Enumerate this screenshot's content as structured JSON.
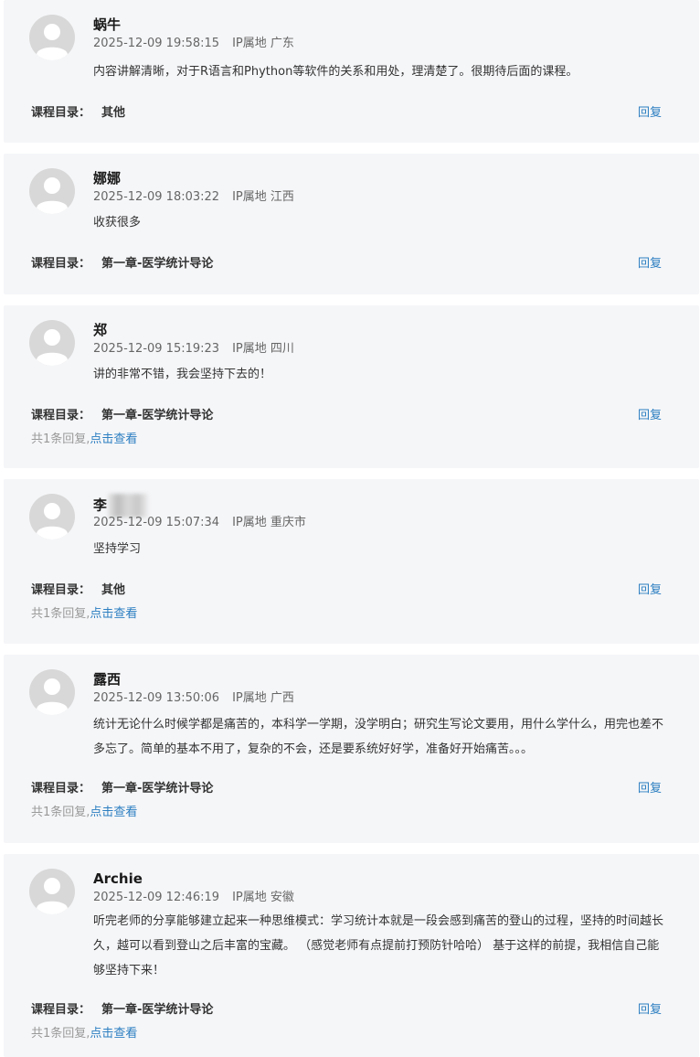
{
  "common": {
    "course_prefix": "课程目录：",
    "reply_label": "回复",
    "view_label": "点击查看"
  },
  "comments": [
    {
      "name": "蜗牛",
      "time": "2025-12-09 19:58:15",
      "ip": "IP属地 广东",
      "content": "内容讲解清晰，对于R语言和Phython等软件的关系和用处，理清楚了。很期待后面的课程。",
      "course": "其他",
      "reply_count": ""
    },
    {
      "name": "娜娜",
      "time": "2025-12-09 18:03:22",
      "ip": "IP属地 江西",
      "content": "收获很多",
      "course": "第一章-医学统计导论",
      "reply_count": ""
    },
    {
      "name": "郑",
      "time": "2025-12-09 15:19:23",
      "ip": "IP属地 四川",
      "content": "讲的非常不错，我会坚持下去的！",
      "course": "第一章-医学统计导论",
      "reply_count": "共1条回复,"
    },
    {
      "name": "李",
      "time": "2025-12-09 15:07:34",
      "ip": "IP属地 重庆市",
      "content": "坚持学习",
      "course": "其他",
      "reply_count": "共1条回复,"
    },
    {
      "name": "露西",
      "time": "2025-12-09 13:50:06",
      "ip": "IP属地 广西",
      "content": "统计无论什么时候学都是痛苦的，本科学一学期，没学明白；研究生写论文要用，用什么学什么，用完也差不多忘了。简单的基本不用了，复杂的不会，还是要系统好好学，准备好开始痛苦。。。",
      "course": "第一章-医学统计导论",
      "reply_count": "共1条回复,"
    },
    {
      "name": "Archie",
      "time": "2025-12-09 12:46:19",
      "ip": "IP属地 安徽",
      "content": "听完老师的分享能够建立起来一种思维模式：学习统计本就是一段会感到痛苦的登山的过程，坚持的时间越长久，越可以看到登山之后丰富的宝藏。 （感觉老师有点提前打预防针哈哈） 基于这样的前提，我相信自己能够坚持下来！",
      "course": "第一章-医学统计导论",
      "reply_count": "共1条回复,"
    }
  ]
}
